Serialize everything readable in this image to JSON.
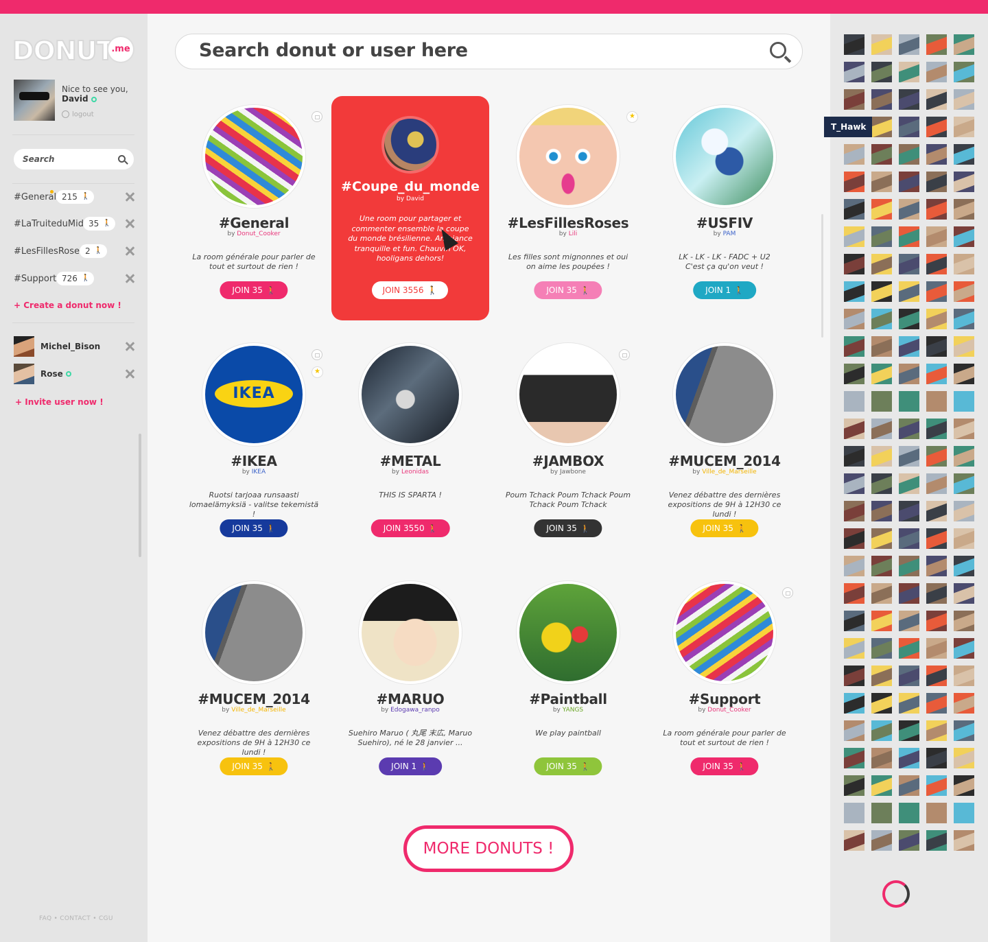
{
  "app": {
    "logo": "DONUT",
    "logo_suffix": ".me"
  },
  "colors": {
    "accent": "#ef2a6c",
    "online": "#3dd8a5",
    "featured": "#f23a3a"
  },
  "profile": {
    "greeting": "Nice to see you,",
    "name": "David",
    "logout": "logout"
  },
  "sidebar": {
    "search_placeholder": "Search",
    "rooms": [
      {
        "name": "#General",
        "count": "215",
        "unread": true
      },
      {
        "name": "#LaTruiteduMidi",
        "count": "35",
        "unread": false
      },
      {
        "name": "#LesFillesRoses",
        "count": "2",
        "unread": false
      },
      {
        "name": "#Support",
        "count": "726",
        "unread": false
      }
    ],
    "create_link": "+ Create a donut now !",
    "users": [
      {
        "name": "Michel_Bison",
        "online": false
      },
      {
        "name": "Rose",
        "online": true
      }
    ],
    "invite_link": "+ Invite user now !",
    "footer": "FAQ • CONTACT • CGU"
  },
  "main": {
    "search_placeholder": "Search donut or user here",
    "featured": {
      "title": "#Coupe_du_monde",
      "by": "by David",
      "description": "Une room pour partager et commenter ensemble la coupe du monde brésilienne. Ambiance tranquille et fun. Chauvin OK, hooligans dehors!",
      "join": "JOIN 3556"
    },
    "cards": [
      {
        "title": "#General",
        "by": "by",
        "by_user": "Donut_Cooker",
        "desc": "La room générale pour parler de tout et surtout de rien !",
        "join": "JOIN 35",
        "color": "#ef2a6c"
      },
      {
        "title": "#LesFillesRoses",
        "by": "by",
        "by_user": "Lili",
        "desc": "Les filles sont mignonnes et oui on aime les poupées !",
        "join": "JOIN 35",
        "color": "#f57fb6"
      },
      {
        "title": "#USFIV",
        "by": "by",
        "by_user": "PAM",
        "desc": "LK - LK - LK - FADC + U2\nC'est ça qu'on veut !",
        "join": "JOIN 1",
        "color": "#1fa8c4"
      },
      {
        "title": "#IKEA",
        "by": "by",
        "by_user": "IKEA",
        "desc": "Ruotsi tarjoaa runsaasti lomaelämyksiä - valitse tekemistä !",
        "join": "JOIN 35",
        "color": "#163a9c",
        "logo_text": "IKEA"
      },
      {
        "title": "#METAL",
        "by": "by",
        "by_user": "Leonidas",
        "desc": "THIS IS SPARTA !",
        "join": "JOIN 3550",
        "color": "#ef2a6c"
      },
      {
        "title": "#JAMBOX",
        "by": "by Jawbone",
        "by_user": "",
        "desc": "Poum Tchack Poum Tchack Poum Tchack Poum Tchack",
        "join": "JOIN 35",
        "color": "#333333"
      },
      {
        "title": "#MUCEM_2014",
        "by": "by",
        "by_user": "Ville_de_Marseille",
        "desc": "Venez débattre des dernières expositions de 9H à 12H30 ce lundi !",
        "join": "JOIN 35",
        "color": "#f7c20e"
      },
      {
        "title": "#MUCEM_2014",
        "by": "by",
        "by_user": "Ville_de_Marseille",
        "desc": "Venez débattre des dernières expositions de 9H à 12H30 ce lundi !",
        "join": "JOIN 35",
        "color": "#f7c20e"
      },
      {
        "title": "#MARUO",
        "by": "by",
        "by_user": "Edogawa_ranpo",
        "desc": "Suehiro Maruo ( 丸尾 末広, Maruo Suehiro), né le 28 janvier ...",
        "join": "JOIN 1",
        "color": "#5b3bb0"
      },
      {
        "title": "#Paintball",
        "by": "by",
        "by_user": "YANGS",
        "desc": "We play paintball",
        "join": "JOIN 35",
        "color": "#8fc53b"
      },
      {
        "title": "#Support",
        "by": "by",
        "by_user": "Donut_Cooker",
        "desc": "La room générale pour parler de tout et surtout de rien !",
        "join": "JOIN 35",
        "color": "#ef2a6c"
      }
    ],
    "more_button": "MORE DONUTS !"
  },
  "right": {
    "tooltip_user": "T_Hawk"
  }
}
